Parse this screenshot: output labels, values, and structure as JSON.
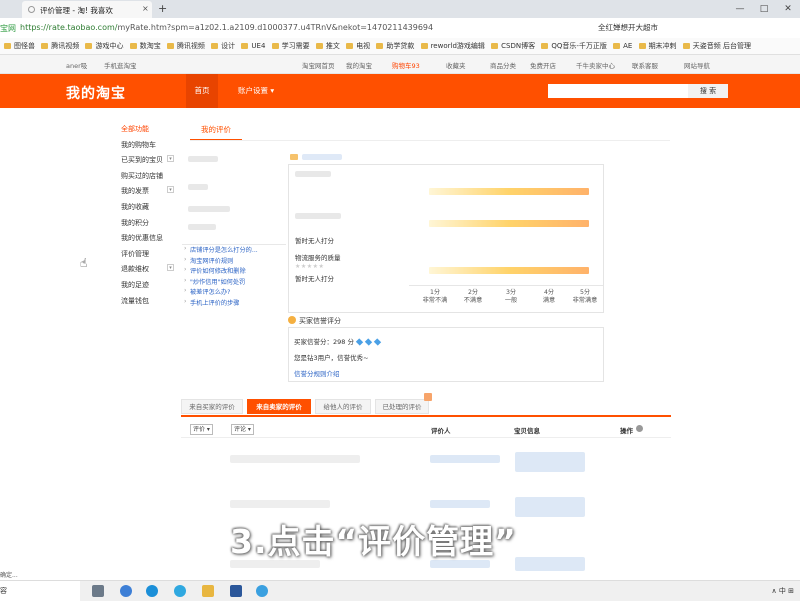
{
  "browser": {
    "tab_title": "评价管理 - 淘! 我喜欢",
    "tab_close": "×",
    "new_tab": "+",
    "window_controls": [
      "—",
      "□",
      "✕"
    ],
    "secure_label": "宝网",
    "url_host": "https://rate.taobao.com/",
    "url_rest": "myRate.htm?spm=a1z02.1.a2109.d1000377.u4TRnV&nekot=1470211439694",
    "right_text": "全红婵想开大超市"
  },
  "bookmarks": [
    "图怪兽",
    "腾讯视频",
    "游戏中心",
    "数淘宝",
    "腾讯视频",
    "设计",
    "UE4",
    "学习需要",
    "推文",
    "电视",
    "助学贷款",
    "reworld游戏编辑",
    "CSDN博客",
    "QQ音乐-千万正版",
    "AE",
    "期末冲刺",
    "天姿音频 后台管理"
  ],
  "topnav": {
    "user": "aner吸",
    "mobile": "手机逛淘宝",
    "home": "淘宝网首页",
    "my": "我的淘宝",
    "cart": "购物车93",
    "fav": "收藏夹",
    "cat": "商品分类",
    "free": "免费开店",
    "seller": "千牛卖家中心",
    "service": "联系客服",
    "sitenav": "网站导航"
  },
  "header": {
    "logo": "我的淘宝",
    "nav_home": "首页",
    "nav_account": "账户设置",
    "search_btn": "搜 索"
  },
  "sidebar": {
    "items": [
      "全部功能",
      "我的购物车",
      "已买到的宝贝",
      "购买过的店铺",
      "我的发票",
      "我的收藏",
      "我的积分",
      "我的优惠信息",
      "评价管理",
      "退款维权",
      "我的足迹",
      "流量钱包"
    ]
  },
  "main": {
    "rate_tab": "我的评价",
    "faq": [
      "店铺评分是怎么打分的...",
      "淘宝网评价规则",
      "评价如何修改和删除",
      "\"炒作信用\"如何处罚",
      "被差评怎么办?",
      "手机上评价的步骤"
    ],
    "dsr": {
      "lines": [
        "暂时无人打分",
        "物流服务的质量",
        "暂时无人打分"
      ],
      "stars": "★★★★★",
      "scale": [
        {
          "n": "1分",
          "t": "非常不满"
        },
        {
          "n": "2分",
          "t": "不满意"
        },
        {
          "n": "3分",
          "t": "一般"
        },
        {
          "n": "4分",
          "t": "满意"
        },
        {
          "n": "5分",
          "t": "非常满意"
        }
      ]
    },
    "credit": {
      "title": "买家信誉评分",
      "score": "买家信誉分：298 分",
      "user_line": "您是钻3用户，信誉优秀~",
      "link": "信誉分规则介绍"
    },
    "tabs": [
      "来自买家的评价",
      "来自卖家的评价",
      "给他人的评价",
      "已处理的评价"
    ],
    "filters": [
      "评价 ▾",
      "评论 ▾"
    ],
    "columns": [
      "评价人",
      "宝贝信息",
      "操作"
    ]
  },
  "subtitle": "3.点击“评价管理”",
  "status_text": "确定...",
  "taskbar": {
    "search": "容",
    "tray": "∧  中  ⊞"
  }
}
